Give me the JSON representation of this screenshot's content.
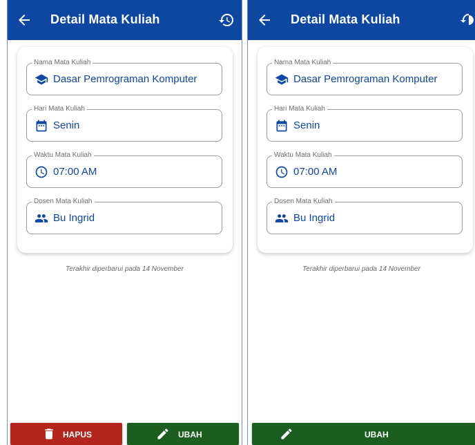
{
  "colors": {
    "appbar": "#0d47a1",
    "value_text": "#0d47a1",
    "delete_button": "#b3261e",
    "edit_button": "#1b5e20"
  },
  "screens": [
    {
      "appbar": {
        "title": "Detail Mata Kuliah",
        "back_icon": "arrow-left-icon",
        "action_icon": "history-icon"
      },
      "fields": [
        {
          "label": "Nama Mata Kuliah",
          "value": "Dasar Pemrograman Komputer",
          "icon": "school-icon"
        },
        {
          "label": "Hari Mata Kuliah",
          "value": "Senin",
          "icon": "calendar-icon"
        },
        {
          "label": "Waktu Mata Kuliah",
          "value": "07:00 AM",
          "icon": "clock-icon"
        },
        {
          "label": "Dosen Mata Kuliah",
          "value": "Bu Ingrid",
          "icon": "people-icon"
        }
      ],
      "updated_text": "Terakhir diperbarui pada 14 November",
      "buttons": {
        "delete_label": "HAPUS",
        "edit_label": "UBAH"
      }
    },
    {
      "appbar": {
        "title": "Detail Mata Kuliah",
        "back_icon": "arrow-left-icon",
        "action_icon": "history-icon"
      },
      "fields": [
        {
          "label": "Nama Mata Kuliah",
          "value": "Dasar Pemrograman Komputer",
          "icon": "school-icon"
        },
        {
          "label": "Hari Mata Kuliah",
          "value": "Senin",
          "icon": "calendar-icon"
        },
        {
          "label": "Waktu Mata Kuliah",
          "value": "07:00 AM",
          "icon": "clock-icon"
        },
        {
          "label": "Dosen Mata Kuliah",
          "value": "Bu Ingrid",
          "icon": "people-icon"
        }
      ],
      "updated_text": "Terakhir diperbarui pada 14 November",
      "buttons": {
        "edit_label": "UBAH"
      }
    }
  ]
}
